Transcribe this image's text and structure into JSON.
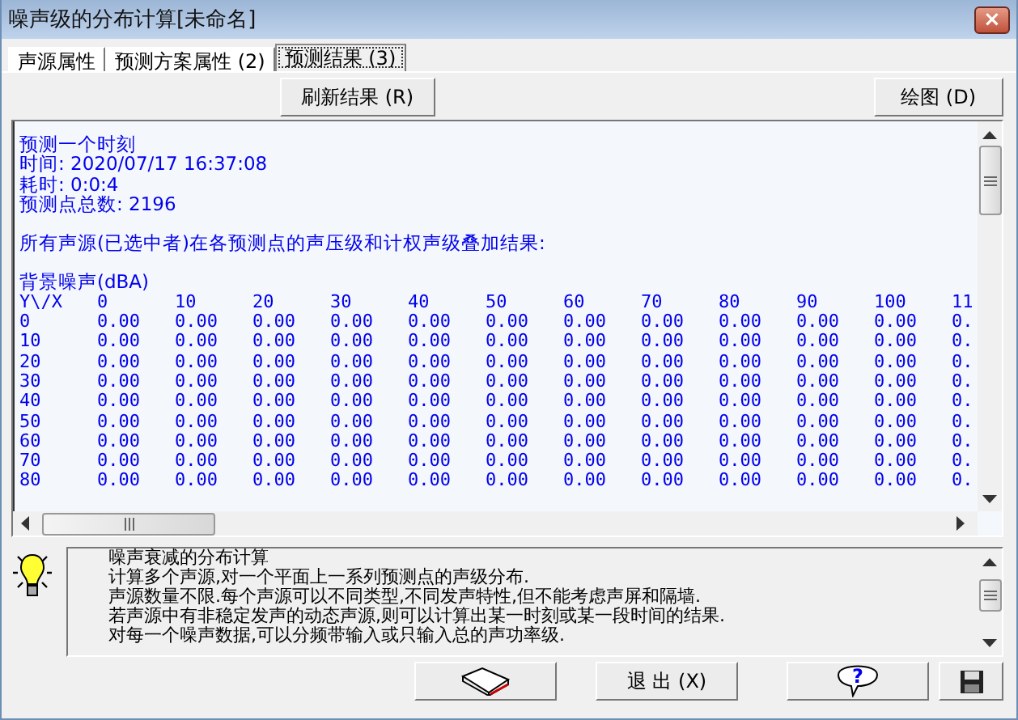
{
  "window": {
    "title": "噪声级的分布计算[未命名]",
    "close": "×"
  },
  "tabs": [
    {
      "label": "声源属性",
      "selected": false
    },
    {
      "label": "预测方案属性 (2)",
      "selected": false
    },
    {
      "label": "预测结果 (3)",
      "selected": true
    }
  ],
  "toolbar": {
    "refresh": "刷新结果 (R)",
    "plot": "绘图 (D)"
  },
  "output": {
    "header_lines": [
      "预测一个时刻",
      "时间: 2020/07/17 16:37:08",
      "耗时: 0:0:4",
      "预测点总数: 2196"
    ],
    "summary": "所有声源(已选中者)在各预测点的声压级和计权声级叠加结果:",
    "section": "背景噪声(dBA)",
    "corner": "Y\\/X",
    "columns": [
      "0",
      "10",
      "20",
      "30",
      "40",
      "50",
      "60",
      "70",
      "80",
      "90",
      "100",
      "11"
    ],
    "rows": [
      {
        "label": "0",
        "cells": [
          "0.00",
          "0.00",
          "0.00",
          "0.00",
          "0.00",
          "0.00",
          "0.00",
          "0.00",
          "0.00",
          "0.00",
          "0.00",
          "0."
        ]
      },
      {
        "label": "10",
        "cells": [
          "0.00",
          "0.00",
          "0.00",
          "0.00",
          "0.00",
          "0.00",
          "0.00",
          "0.00",
          "0.00",
          "0.00",
          "0.00",
          "0."
        ]
      },
      {
        "label": "20",
        "cells": [
          "0.00",
          "0.00",
          "0.00",
          "0.00",
          "0.00",
          "0.00",
          "0.00",
          "0.00",
          "0.00",
          "0.00",
          "0.00",
          "0."
        ]
      },
      {
        "label": "30",
        "cells": [
          "0.00",
          "0.00",
          "0.00",
          "0.00",
          "0.00",
          "0.00",
          "0.00",
          "0.00",
          "0.00",
          "0.00",
          "0.00",
          "0."
        ]
      },
      {
        "label": "40",
        "cells": [
          "0.00",
          "0.00",
          "0.00",
          "0.00",
          "0.00",
          "0.00",
          "0.00",
          "0.00",
          "0.00",
          "0.00",
          "0.00",
          "0."
        ]
      },
      {
        "label": "50",
        "cells": [
          "0.00",
          "0.00",
          "0.00",
          "0.00",
          "0.00",
          "0.00",
          "0.00",
          "0.00",
          "0.00",
          "0.00",
          "0.00",
          "0."
        ]
      },
      {
        "label": "60",
        "cells": [
          "0.00",
          "0.00",
          "0.00",
          "0.00",
          "0.00",
          "0.00",
          "0.00",
          "0.00",
          "0.00",
          "0.00",
          "0.00",
          "0."
        ]
      },
      {
        "label": "70",
        "cells": [
          "0.00",
          "0.00",
          "0.00",
          "0.00",
          "0.00",
          "0.00",
          "0.00",
          "0.00",
          "0.00",
          "0.00",
          "0.00",
          "0."
        ]
      },
      {
        "label": "80",
        "cells": [
          "0.00",
          "0.00",
          "0.00",
          "0.00",
          "0.00",
          "0.00",
          "0.00",
          "0.00",
          "0.00",
          "0.00",
          "0.00",
          "0."
        ]
      }
    ]
  },
  "info": {
    "lines": [
      "噪声衰减的分布计算",
      "计算多个声源,对一个平面上一系列预测点的声级分布.",
      "声源数量不限.每个声源可以不同类型,不同发声特性,但不能考虑声屏和隔墙.",
      "若声源中有非稳定发声的动态声源,则可以计算出某一时刻或某一段时间的结果.",
      "对每一个噪声数据,可以分频带输入或只输入总的声功率级."
    ]
  },
  "footer": {
    "exit": "退 出 (X)",
    "help": "?"
  }
}
